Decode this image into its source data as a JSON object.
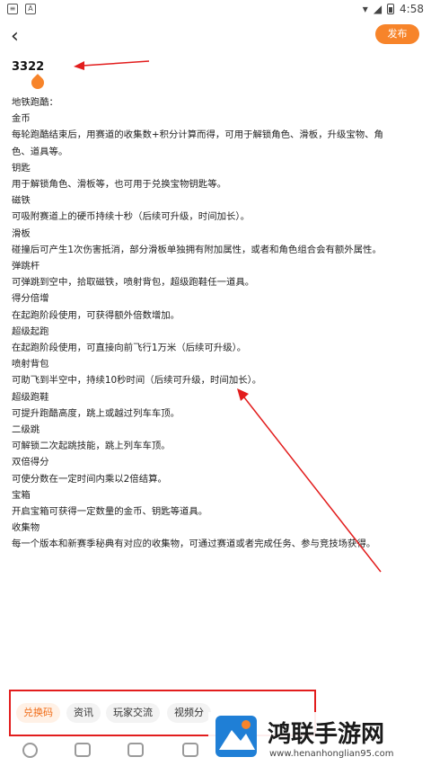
{
  "status": {
    "time": "4:58"
  },
  "header": {
    "back_icon": "back-arrow-icon",
    "publish_label": "发布"
  },
  "post": {
    "title": "3322",
    "lines": [
      "地铁跑酷：",
      "金币",
      "每轮跑酷结束后，用赛道的收集数+积分计算而得，可用于解锁角色、滑板，升级宝物、角",
      "色、道具等。",
      "钥匙",
      "用于解锁角色、滑板等，也可用于兑换宝物钥匙等。",
      "磁铁",
      "可吸附赛道上的硬币持续十秒（后续可升级，时间加长）。",
      "滑板",
      "碰撞后可产生1次伤害抵消，部分滑板单独拥有附加属性，或者和角色组合会有额外属性。",
      "弹跳杆",
      "可弹跳到空中，拾取磁铁，喷射背包，超级跑鞋任一道具。",
      "得分倍增",
      "在起跑阶段使用，可获得额外倍数增加。",
      "超级起跑",
      "在起跑阶段使用，可直接向前飞行1万米（后续可升级）。",
      "喷射背包",
      "可助飞到半空中，持续10秒时间（后续可升级，时间加长）。",
      "超级跑鞋",
      "可提升跑酷高度，跳上或越过列车车顶。",
      "二级跳",
      "可解锁二次起跳技能，跳上列车车顶。",
      "双倍得分",
      "可使分数在一定时间内乘以2倍结算。",
      "宝箱",
      "开启宝箱可获得一定数量的金币、钥匙等道具。",
      "收集物",
      "每一个版本和新赛季秘典有对应的收集物，可通过赛道或者完成任务、参与竞技场获得。"
    ]
  },
  "tags": [
    {
      "label": "兑换码",
      "active": true
    },
    {
      "label": "资讯",
      "active": false
    },
    {
      "label": "玩家交流",
      "active": false
    },
    {
      "label": "视频分",
      "active": false
    }
  ],
  "toolbar": [
    "emoji-icon",
    "image-icon",
    "video-icon",
    "game-icon"
  ],
  "watermark": {
    "name": "鸿联手游网",
    "url": "www.henanhonglian95.com"
  },
  "colors": {
    "accent": "#f7842a",
    "annotation": "#e21d1d"
  }
}
